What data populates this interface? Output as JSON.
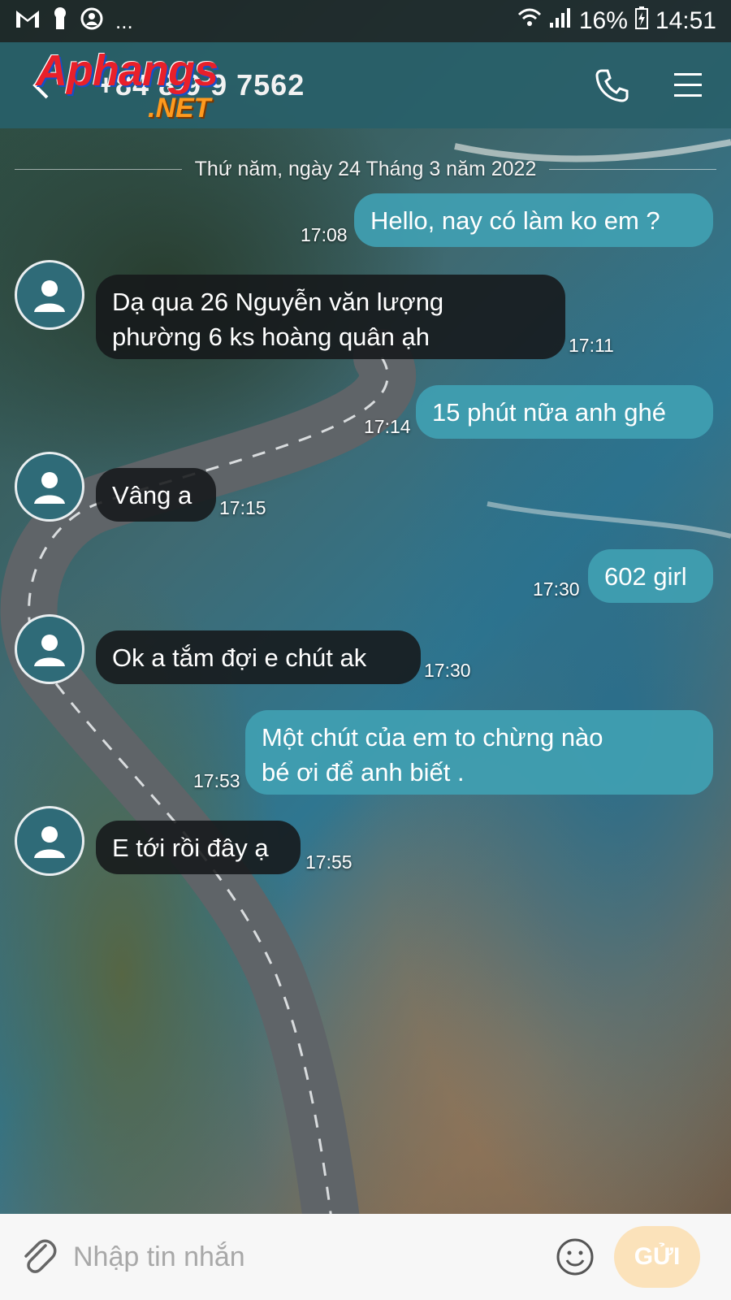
{
  "status_bar": {
    "battery": "16%",
    "time": "14:51",
    "more": "..."
  },
  "header": {
    "contact": "+84 8 9 9 7562",
    "back_icon": "chevron-left-icon",
    "call_icon": "phone-icon",
    "menu_icon": "menu-icon"
  },
  "watermark": {
    "top": "Aphangs",
    "bottom": ".NET"
  },
  "conversation": {
    "date": "Thứ năm, ngày 24 Tháng 3 năm 2022",
    "messages": [
      {
        "dir": "out",
        "lines": [
          "Hello, nay có làm ko em ?"
        ],
        "time": "17:08"
      },
      {
        "dir": "in",
        "lines": [
          "Dạ qua 26 Nguyễn văn lượng",
          "phường 6 ks hoàng quân ạh"
        ],
        "time": "17:11"
      },
      {
        "dir": "out",
        "lines": [
          "15 phút nữa anh ghé"
        ],
        "time": "17:14"
      },
      {
        "dir": "in",
        "lines": [
          "Vâng a"
        ],
        "time": "17:15"
      },
      {
        "dir": "out",
        "lines": [
          "602 girl"
        ],
        "time": "17:30"
      },
      {
        "dir": "in",
        "lines": [
          "Ok a tắm đợi e chút ak"
        ],
        "time": "17:30"
      },
      {
        "dir": "out",
        "lines": [
          "Một chút của em to chừng nào",
          "bé ơi để anh biết ."
        ],
        "time": "17:53"
      },
      {
        "dir": "in",
        "lines": [
          "E tới rồi đây ạ"
        ],
        "time": "17:55"
      }
    ]
  },
  "compose": {
    "placeholder": "Nhập tin nhắn",
    "send_label": "GỬI"
  },
  "colors": {
    "header": "#285f69",
    "outgoing_bubble": "#40a0b2",
    "incoming_bubble": "#16181a",
    "send_button": "#fbe2ba"
  }
}
